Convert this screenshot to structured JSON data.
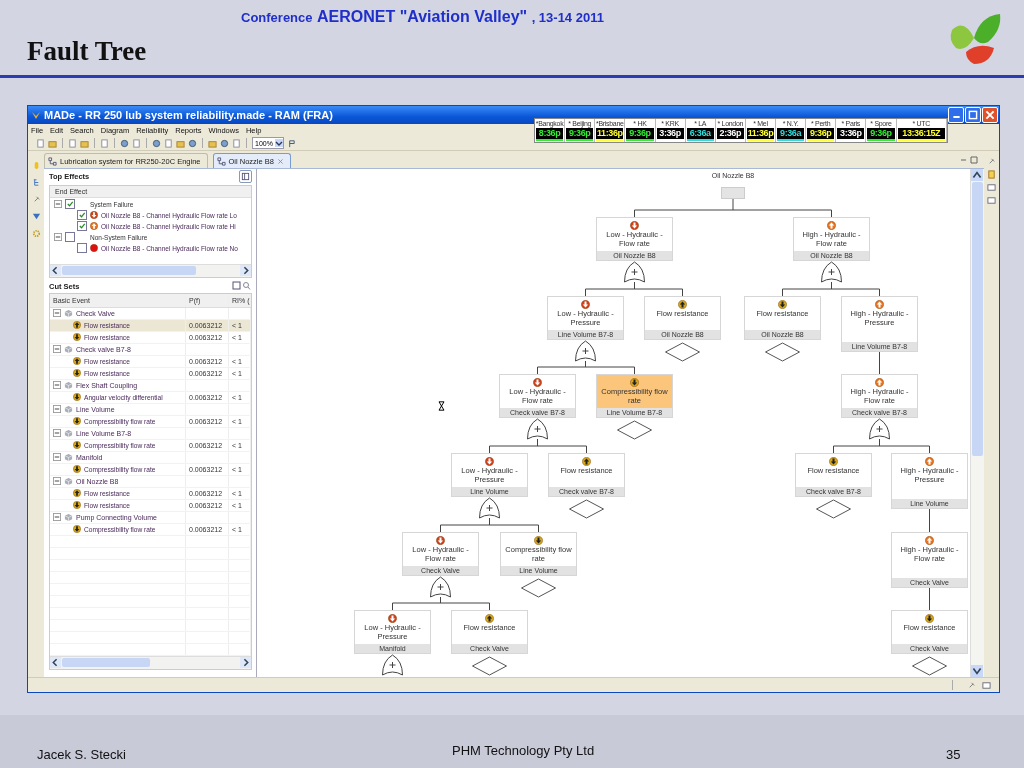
{
  "slide": {
    "conference_prefix": "Conference",
    "conference_name": "AERONET \"Aviation Valley\"",
    "conference_dates": ", 13-14 2011",
    "title": "Fault Tree",
    "footer_left": "Jacek S. Stecki",
    "footer_center": "PHM Technology Pty Ltd",
    "page_number": "35"
  },
  "window": {
    "title": "MADe - RR 250 lub system reliability.made - RAM (FRA)"
  },
  "menu": [
    "File",
    "Edit",
    "Search",
    "Diagram",
    "Reliability",
    "Reports",
    "Windows",
    "Help"
  ],
  "zoom": {
    "value": "100%"
  },
  "clocks": [
    {
      "city": "*Bangkok",
      "time": "8:36p",
      "color": "#33ee33"
    },
    {
      "city": "* Beijing",
      "time": "9:36p",
      "color": "#33ee33"
    },
    {
      "city": "*Brisbane",
      "time": "11:36p",
      "color": "#ffff33"
    },
    {
      "city": "* HK",
      "time": "9:36p",
      "color": "#33ee33"
    },
    {
      "city": "* KRK",
      "time": "3:36p",
      "color": "#ffffff"
    },
    {
      "city": "* LA",
      "time": "6:36a",
      "color": "#33dddd"
    },
    {
      "city": "* London",
      "time": "2:36p",
      "color": "#ffffff"
    },
    {
      "city": "* Mel",
      "time": "11:36p",
      "color": "#ffff33"
    },
    {
      "city": "* N.Y.",
      "time": "9:36a",
      "color": "#33dddd"
    },
    {
      "city": "* Perth",
      "time": "9:36p",
      "color": "#ffff33"
    },
    {
      "city": "* Paris",
      "time": "3:36p",
      "color": "#ffffff"
    },
    {
      "city": "* Spore",
      "time": "9:36p",
      "color": "#33ee33"
    },
    {
      "city": "* UTC",
      "time": "13:36:15Z",
      "color": "#ffff33"
    }
  ],
  "editor_tabs": [
    {
      "label": "Lubrication system for RR250-20C Engine",
      "selected": false
    },
    {
      "label": "Oil Nozzle B8",
      "selected": true
    }
  ],
  "top_effects": {
    "title": "Top Effects",
    "column": "End Effect",
    "items": [
      {
        "label": "System Failure",
        "checked": true,
        "expanded": true,
        "children": [
          {
            "label": "Oil Nozzle B8 - Channel Hydraulic Flow rate Lo",
            "checked": true,
            "kind": "low"
          },
          {
            "label": "Oil Nozzle B8 - Channel Hydraulic Flow rate Hi",
            "checked": true,
            "kind": "high"
          }
        ]
      },
      {
        "label": "Non-System Failure",
        "checked": false,
        "expanded": true,
        "children": [
          {
            "label": "Oil Nozzle B8 - Channel Hydraulic Flow rate No",
            "checked": false,
            "kind": "failed"
          }
        ]
      }
    ]
  },
  "cut_sets": {
    "title": "Cut Sets",
    "columns": [
      "Basic Event",
      "P(f)",
      "RI% ("
    ],
    "groups": [
      {
        "label": "Check Valve",
        "expanded": true,
        "rows": [
          {
            "event": "Flow resistance",
            "kind": "highbasic",
            "pf": "0.0063212",
            "ri": "< 1",
            "selected": true
          },
          {
            "event": "Flow resistance",
            "kind": "lowbasic",
            "pf": "0.0063212",
            "ri": "< 1",
            "selected": false
          }
        ]
      },
      {
        "label": "Check valve B7-8",
        "expanded": true,
        "rows": [
          {
            "event": "Flow resistance",
            "kind": "highbasic",
            "pf": "0.0063212",
            "ri": "< 1",
            "selected": false
          },
          {
            "event": "Flow resistance",
            "kind": "lowbasic",
            "pf": "0.0063212",
            "ri": "< 1",
            "selected": false
          }
        ]
      },
      {
        "label": "Flex Shaft Coupling",
        "expanded": true,
        "rows": [
          {
            "event": "Angular velocity differential",
            "kind": "lowbasic",
            "pf": "0.0063212",
            "ri": "< 1",
            "selected": false
          }
        ]
      },
      {
        "label": "Line Volume",
        "expanded": true,
        "rows": [
          {
            "event": "Compressibility flow rate",
            "kind": "lowbasic",
            "pf": "0.0063212",
            "ri": "< 1",
            "selected": false
          }
        ]
      },
      {
        "label": "Line Volume B7-8",
        "expanded": true,
        "rows": [
          {
            "event": "Compressibility flow rate",
            "kind": "lowbasic",
            "pf": "0.0063212",
            "ri": "< 1",
            "selected": false
          }
        ]
      },
      {
        "label": "Manifold",
        "expanded": true,
        "rows": [
          {
            "event": "Compressibility flow rate",
            "kind": "lowbasic",
            "pf": "0.0063212",
            "ri": "< 1",
            "selected": false
          }
        ]
      },
      {
        "label": "Oil Nozzle B8",
        "expanded": true,
        "rows": [
          {
            "event": "Flow resistance",
            "kind": "highbasic",
            "pf": "0.0063212",
            "ri": "< 1",
            "selected": false
          },
          {
            "event": "Flow resistance",
            "kind": "lowbasic",
            "pf": "0.0063212",
            "ri": "< 1",
            "selected": false
          }
        ]
      },
      {
        "label": "Pump Connecting Volume",
        "expanded": true,
        "rows": [
          {
            "event": "Compressibility flow rate",
            "kind": "lowbasic",
            "pf": "0.0063212",
            "ri": "< 1",
            "selected": false
          }
        ]
      }
    ]
  },
  "fault_tree": {
    "root": {
      "label": "Oil Nozzle B8",
      "children": [
        {
          "title": "Low - Hydraulic - Flow rate",
          "component": "Oil Nozzle B8",
          "kind": "low",
          "or_gate": true,
          "selected": false,
          "children": [
            {
              "title": "Low - Hydraulic - Pressure",
              "component": "Line Volume B7-8",
              "kind": "low",
              "or_gate": true,
              "selected": false,
              "children": [
                {
                  "title": "Low - Hydraulic - Flow rate",
                  "component": "Check valve B7-8",
                  "kind": "low",
                  "or_gate": true,
                  "selected": false,
                  "children": [
                    {
                      "title": "Low - Hydraulic - Pressure",
                      "component": "Line Volume",
                      "kind": "low",
                      "or_gate": true,
                      "selected": false,
                      "children": [
                        {
                          "title": "Low - Hydraulic - Flow rate",
                          "component": "Check Valve",
                          "kind": "low",
                          "or_gate": true,
                          "selected": false,
                          "children": [
                            {
                              "title": "Low - Hydraulic - Pressure",
                              "component": "Manifold",
                              "kind": "low",
                              "or_gate": true,
                              "selected": false
                            },
                            {
                              "title": "Flow resistance",
                              "component": "Check Valve",
                              "kind": "highbasic",
                              "or_gate": false,
                              "selected": false
                            }
                          ]
                        },
                        {
                          "title": "Compressibility flow rate",
                          "component": "Line Volume",
                          "kind": "lowbasic",
                          "or_gate": false,
                          "selected": false
                        }
                      ]
                    },
                    {
                      "title": "Flow resistance",
                      "component": "Check valve B7-8",
                      "kind": "highbasic",
                      "or_gate": false,
                      "selected": false
                    }
                  ]
                },
                {
                  "title": "Compressibility flow rate",
                  "component": "Line Volume B7-8",
                  "kind": "lowbasic",
                  "or_gate": false,
                  "selected": true
                }
              ]
            },
            {
              "title": "Flow resistance",
              "component": "Oil Nozzle B8",
              "kind": "highbasic",
              "or_gate": false,
              "selected": false
            }
          ]
        },
        {
          "title": "High - Hydraulic - Flow rate",
          "component": "Oil Nozzle B8",
          "kind": "high",
          "or_gate": true,
          "selected": false,
          "children": [
            {
              "title": "Flow resistance",
              "component": "Oil Nozzle B8",
              "kind": "lowbasic",
              "or_gate": false,
              "selected": false
            },
            {
              "title": "High - Hydraulic - Pressure",
              "component": "Line Volume B7-8",
              "kind": "high",
              "or_gate": false,
              "selected": false,
              "children": [
                {
                  "title": "High - Hydraulic - Flow rate",
                  "component": "Check valve B7-8",
                  "kind": "high",
                  "or_gate": true,
                  "selected": false,
                  "children": [
                    {
                      "title": "Flow resistance",
                      "component": "Check valve B7-8",
                      "kind": "lowbasic",
                      "or_gate": false,
                      "selected": false
                    },
                    {
                      "title": "High - Hydraulic - Pressure",
                      "component": "Line Volume",
                      "kind": "high",
                      "or_gate": false,
                      "selected": false,
                      "children": [
                        {
                          "title": "High - Hydraulic - Flow rate",
                          "component": "Check Valve",
                          "kind": "high",
                          "or_gate": false,
                          "selected": false,
                          "children": [
                            {
                              "title": "Flow resistance",
                              "component": "Check Valve",
                              "kind": "lowbasic",
                              "or_gate": false,
                              "selected": false
                            }
                          ]
                        }
                      ]
                    }
                  ]
                }
              ]
            }
          ]
        }
      ]
    }
  }
}
